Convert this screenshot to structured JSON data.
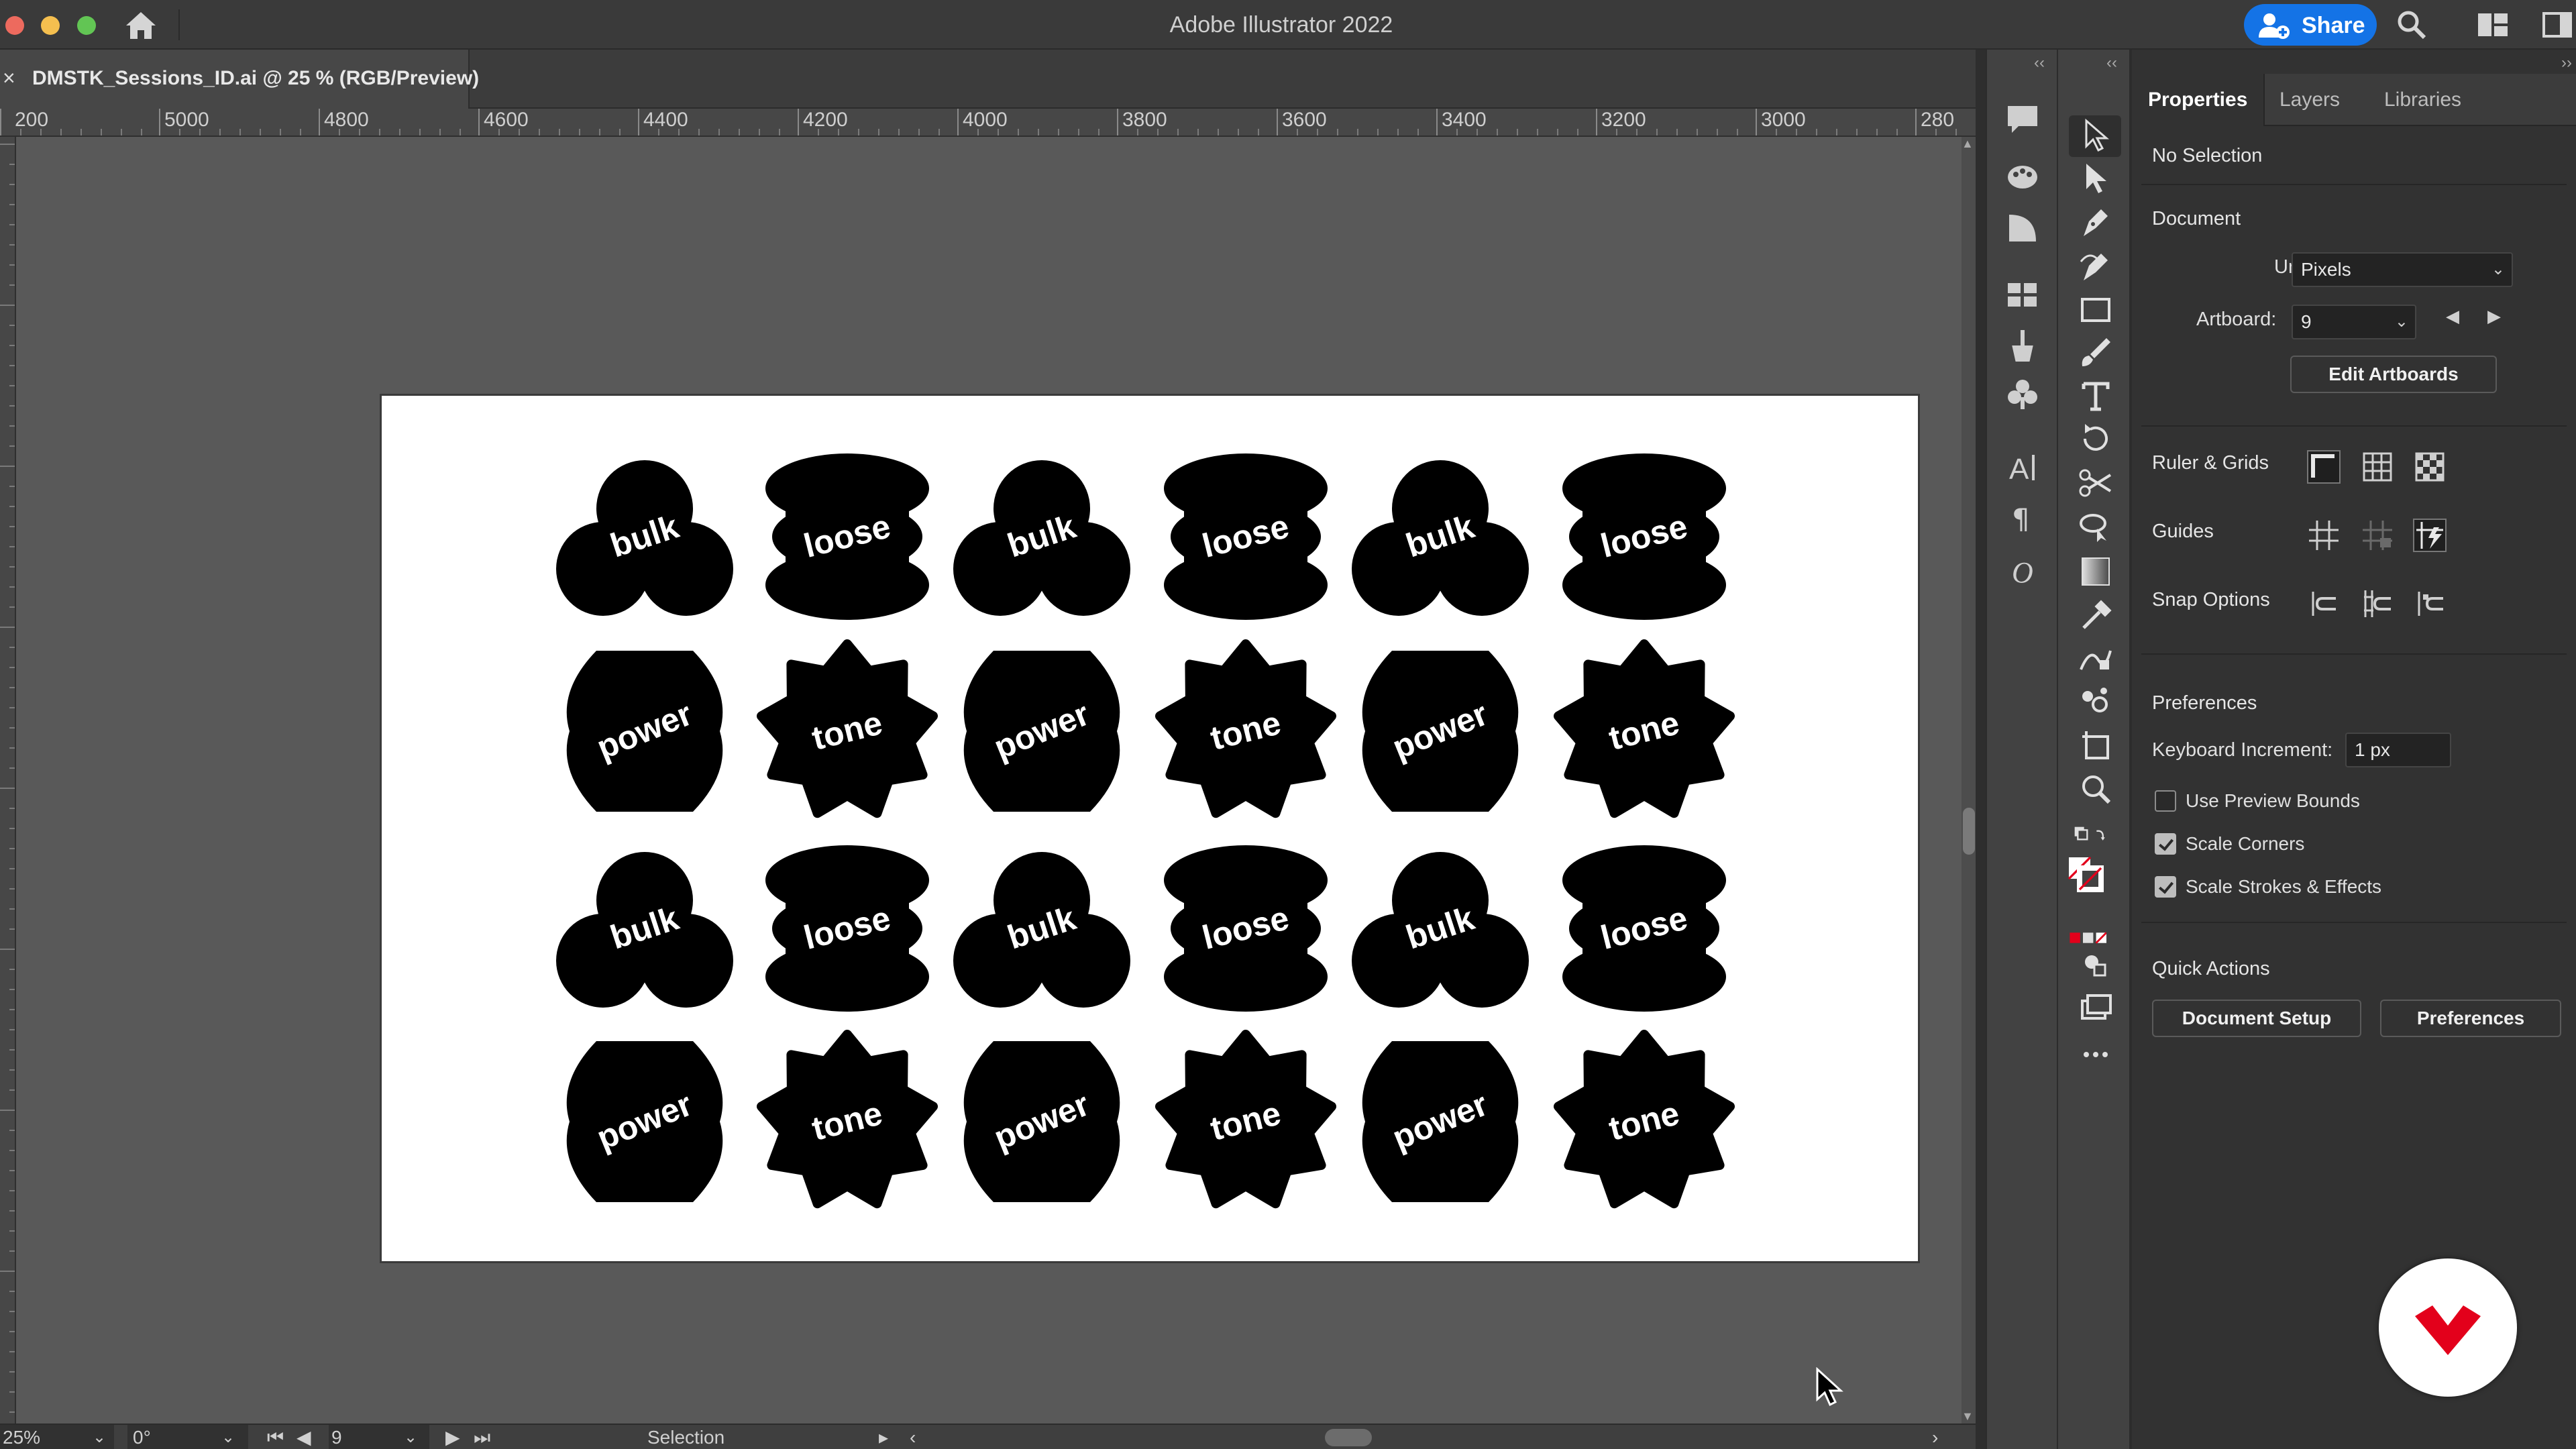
{
  "app": {
    "title": "Adobe Illustrator 2022",
    "share_label": "Share"
  },
  "document_tab": {
    "label": "DMSTK_Sessions_ID.ai @ 25 % (RGB/Preview)",
    "close": "×"
  },
  "ruler": {
    "labels": [
      "200",
      "5000",
      "4800",
      "4600",
      "4400",
      "4200",
      "4000",
      "3800",
      "3600",
      "3400",
      "3200",
      "3000",
      "280"
    ]
  },
  "artboard": {
    "rows": [
      [
        {
          "shape": "bulk",
          "label": "bulk"
        },
        {
          "shape": "loose",
          "label": "loose"
        },
        {
          "shape": "bulk",
          "label": "bulk"
        },
        {
          "shape": "loose",
          "label": "loose"
        },
        {
          "shape": "bulk",
          "label": "bulk"
        },
        {
          "shape": "loose",
          "label": "loose"
        }
      ],
      [
        {
          "shape": "power",
          "label": "power"
        },
        {
          "shape": "tone",
          "label": "tone"
        },
        {
          "shape": "power",
          "label": "power"
        },
        {
          "shape": "tone",
          "label": "tone"
        },
        {
          "shape": "power",
          "label": "power"
        },
        {
          "shape": "tone",
          "label": "tone"
        }
      ],
      [
        {
          "shape": "bulk",
          "label": "bulk"
        },
        {
          "shape": "loose",
          "label": "loose"
        },
        {
          "shape": "bulk",
          "label": "bulk"
        },
        {
          "shape": "loose",
          "label": "loose"
        },
        {
          "shape": "bulk",
          "label": "bulk"
        },
        {
          "shape": "loose",
          "label": "loose"
        }
      ],
      [
        {
          "shape": "power",
          "label": "power"
        },
        {
          "shape": "tone",
          "label": "tone"
        },
        {
          "shape": "power",
          "label": "power"
        },
        {
          "shape": "tone",
          "label": "tone"
        },
        {
          "shape": "power",
          "label": "power"
        },
        {
          "shape": "tone",
          "label": "tone"
        }
      ]
    ]
  },
  "statusbar": {
    "zoom": "25%",
    "rotation": "0°",
    "artboard_number": "9",
    "status": "Selection"
  },
  "properties_panel": {
    "tabs": [
      "Properties",
      "Layers",
      "Libraries"
    ],
    "selection": "No Selection",
    "document": {
      "heading": "Document",
      "units_label": "Units:",
      "units_value": "Pixels",
      "artboard_label": "Artboard:",
      "artboard_value": "9",
      "edit_artboards": "Edit Artboards"
    },
    "ruler_grids": "Ruler & Grids",
    "guides": "Guides",
    "snap_options": "Snap Options",
    "preferences": {
      "heading": "Preferences",
      "keyboard_increment_label": "Keyboard Increment:",
      "keyboard_increment_value": "1 px",
      "checkboxes": [
        {
          "label": "Use Preview Bounds",
          "checked": false
        },
        {
          "label": "Scale Corners",
          "checked": true
        },
        {
          "label": "Scale Strokes & Effects",
          "checked": true
        }
      ]
    },
    "quick_actions": {
      "heading": "Quick Actions",
      "document_setup": "Document Setup",
      "preferences": "Preferences"
    }
  },
  "colors": {
    "accent": "#1473e6",
    "brand_badge": "#e3001b",
    "canvas": "#595959",
    "artwork": "#000000"
  }
}
